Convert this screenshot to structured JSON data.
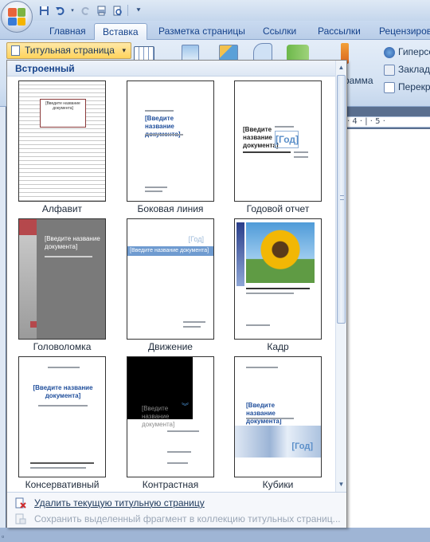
{
  "quick_access": {
    "icons": [
      "save-icon",
      "undo-icon",
      "redo-icon",
      "print-preview-icon",
      "customize-icon"
    ]
  },
  "tabs": [
    {
      "label": "Главная",
      "active": false
    },
    {
      "label": "Вставка",
      "active": true
    },
    {
      "label": "Разметка страницы",
      "active": false
    },
    {
      "label": "Ссылки",
      "active": false
    },
    {
      "label": "Рассылки",
      "active": false
    },
    {
      "label": "Рецензиров",
      "active": false
    }
  ],
  "ribbon": {
    "cover_page_button": "Титульная страница",
    "diagram_label": "рамма",
    "hyperlink_label": "Гиперсс",
    "bookmark_label": "Закладк",
    "crossref_label": "Перекр"
  },
  "ruler": {
    "marks": "· 4 · | · 5 ·"
  },
  "gallery": {
    "section_header": "Встроенный",
    "items": [
      {
        "label": "Алфавит",
        "preview_title": "[Введите название документа]"
      },
      {
        "label": "Боковая линия",
        "preview_title": "[Введите название документа]"
      },
      {
        "label": "Годовой отчет",
        "preview_title": "[Введите название документа]",
        "preview_year": "[Год]"
      },
      {
        "label": "Головоломка",
        "preview_title": "[Введите название документа]"
      },
      {
        "label": "Движение",
        "preview_title": "[Введите название документа]",
        "preview_year": "[Год]"
      },
      {
        "label": "Кадр",
        "preview_title": "[Введите название документа]"
      },
      {
        "label": "Консервативный",
        "preview_title": "[Введите название документа]"
      },
      {
        "label": "Контрастная",
        "preview_title": "[Введите название документа]"
      },
      {
        "label": "Кубики",
        "preview_title": "[Введите название документа]",
        "preview_year": "[Год]"
      }
    ],
    "footer": {
      "remove_label": "Удалить текущую титульную страницу",
      "save_label": "Сохранить выделенный фрагмент в коллекцию титульных страниц..."
    }
  },
  "colors": {
    "accent_blue": "#15428b",
    "hover_gold": "#ffd35c",
    "thumb_blue": "#1f4e9b"
  }
}
